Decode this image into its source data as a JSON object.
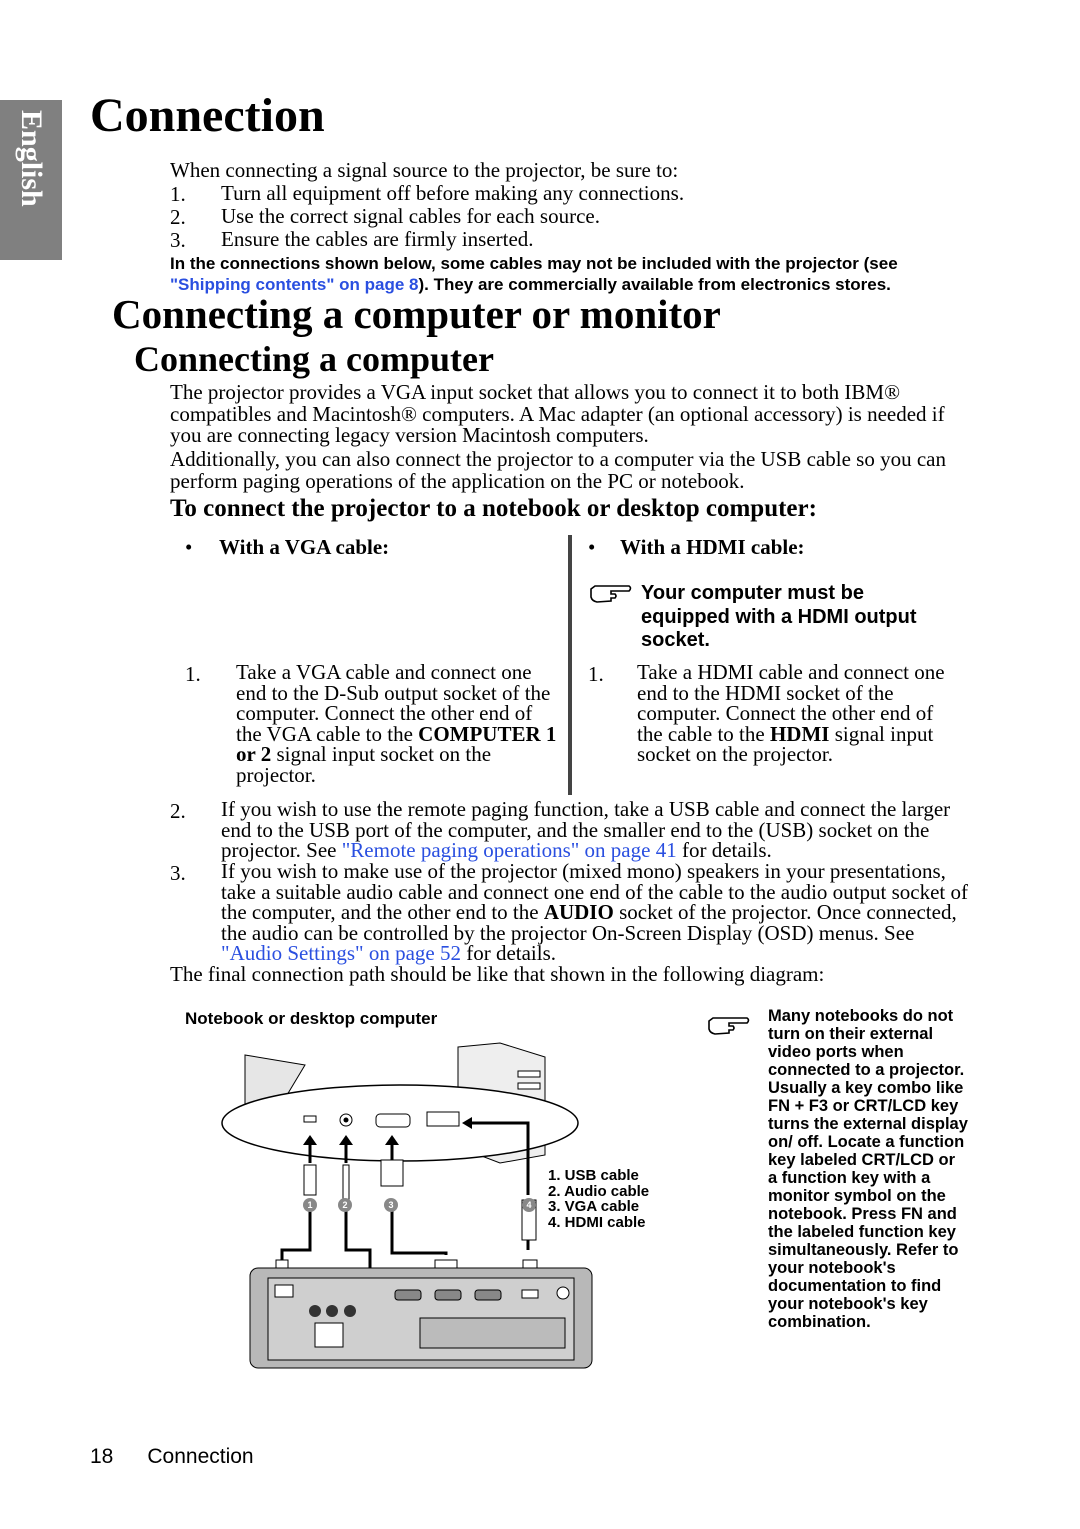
{
  "side_tab": "English",
  "title": "Connection",
  "intro": {
    "lead": "When connecting a signal source to the projector, be sure to:",
    "items": [
      {
        "num": "1.",
        "text": "Turn all equipment off before making any connections."
      },
      {
        "num": "2.",
        "text": "Use the correct signal cables for each source."
      },
      {
        "num": "3.",
        "text": "Ensure the cables are firmly inserted."
      }
    ],
    "note_part1": "In the connections shown below, some cables may not be included with the projector (see ",
    "note_link": "\"Shipping contents\" on page 8",
    "note_part2": "). They are commercially available from electronics stores."
  },
  "section_title": "Connecting a computer or monitor",
  "subsection_title": "Connecting a computer",
  "para1": "The projector provides a VGA input socket that allows you to connect it to both IBM® compatibles and Macintosh® computers. A Mac adapter (an optional accessory) is needed if you are connecting legacy version Macintosh computers.",
  "para2": "Additionally, you can also connect the projector to a computer via the USB cable so you can perform paging operations of the application on the PC or notebook.",
  "procedure_title": "To connect the projector to a notebook or desktop computer:",
  "left_col": {
    "bullet": "•",
    "heading": "With a VGA cable:",
    "step_num": "1.",
    "step_a": "Take a VGA cable and connect one end to the D-Sub output socket of the computer. Connect the other end of the VGA cable to the ",
    "step_bold": "COMPUTER 1 or 2",
    "step_b": " signal input socket on the projector."
  },
  "right_col": {
    "bullet": "•",
    "heading": "With a HDMI cable:",
    "note_icon": "pointing-hand-icon",
    "note": "Your computer must be equipped with a HDMI output socket.",
    "step_num": "1.",
    "step_a": "Take a HDMI cable and connect one end to the HDMI socket of the computer. Connect the other end of the cable to the ",
    "step_bold": "HDMI",
    "step_b": " signal input socket on the projector."
  },
  "step2": {
    "num": "2.",
    "text_a": "If you wish to use the remote paging function, take a USB cable and connect the larger end to the USB port of the computer, and the smaller end to the (USB) socket on the projector. See ",
    "link": "\"Remote paging operations\" on page 41",
    "text_b": " for details."
  },
  "step3": {
    "num": "3.",
    "text_a": "If you wish to make use of the projector (mixed mono) speakers in your presentations, take a suitable audio cable and connect one end of the cable to the audio output socket of the computer, and the other end to the ",
    "bold": "AUDIO",
    "text_b": " socket of the projector. Once connected, the audio can be controlled by the projector On-Screen Display (OSD) menus. See ",
    "link": "\"Audio Settings\" on page 52",
    "text_c": " for details."
  },
  "final_line": "The final connection path should be like that shown in the following diagram:",
  "diagram": {
    "caption": "Notebook or desktop computer",
    "legend": [
      "1. USB cable",
      "2. Audio cable",
      "3. VGA cable",
      "4. HDMI cable"
    ],
    "markers": [
      "1",
      "2",
      "3",
      "4"
    ]
  },
  "side_note": {
    "icon": "pointing-hand-icon",
    "text": "Many notebooks do not turn on their external video ports when connected to a projector. Usually a key combo like FN + F3 or CRT/LCD key turns the external display on/ off. Locate a function key labeled CRT/LCD or a function key with a monitor symbol on the notebook. Press FN and the labeled function key simultaneously. Refer to your notebook's documentation to find your notebook's key combination."
  },
  "footer": {
    "page_num": "18",
    "section": "Connection"
  }
}
